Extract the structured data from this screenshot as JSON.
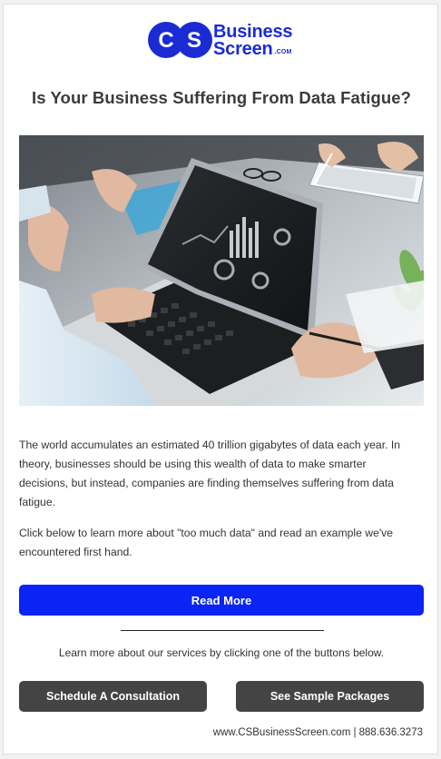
{
  "brand": {
    "logo_mark": "CS",
    "name_line1": "Business",
    "name_line2": "Screen",
    "tld": ".COM",
    "color": "#1b2bd4"
  },
  "article": {
    "title": "Is Your Business Suffering From Data Fatigue?",
    "hero_image": "laptop-analytics-meeting-photo",
    "paragraph1": "The world accumulates an estimated 40 trillion gigabytes of data each year. In theory, businesses should be using this wealth of data to make smarter decisions, but instead, companies are finding themselves suffering from data fatigue.",
    "paragraph2": "Click below to learn more about \"too much data\" and read an example we've encountered first hand.",
    "read_more_label": "Read More"
  },
  "services": {
    "prompt": "Learn more about our services by clicking one of the buttons below.",
    "consultation_label": "Schedule A Consultation",
    "packages_label": "See Sample Packages"
  },
  "footer": {
    "contact": "www.CSBusinessScreen.com | 888.636.3273"
  },
  "colors": {
    "primary_button": "#0a24f5",
    "secondary_button": "#444444",
    "title_text": "#3b3b3b"
  }
}
